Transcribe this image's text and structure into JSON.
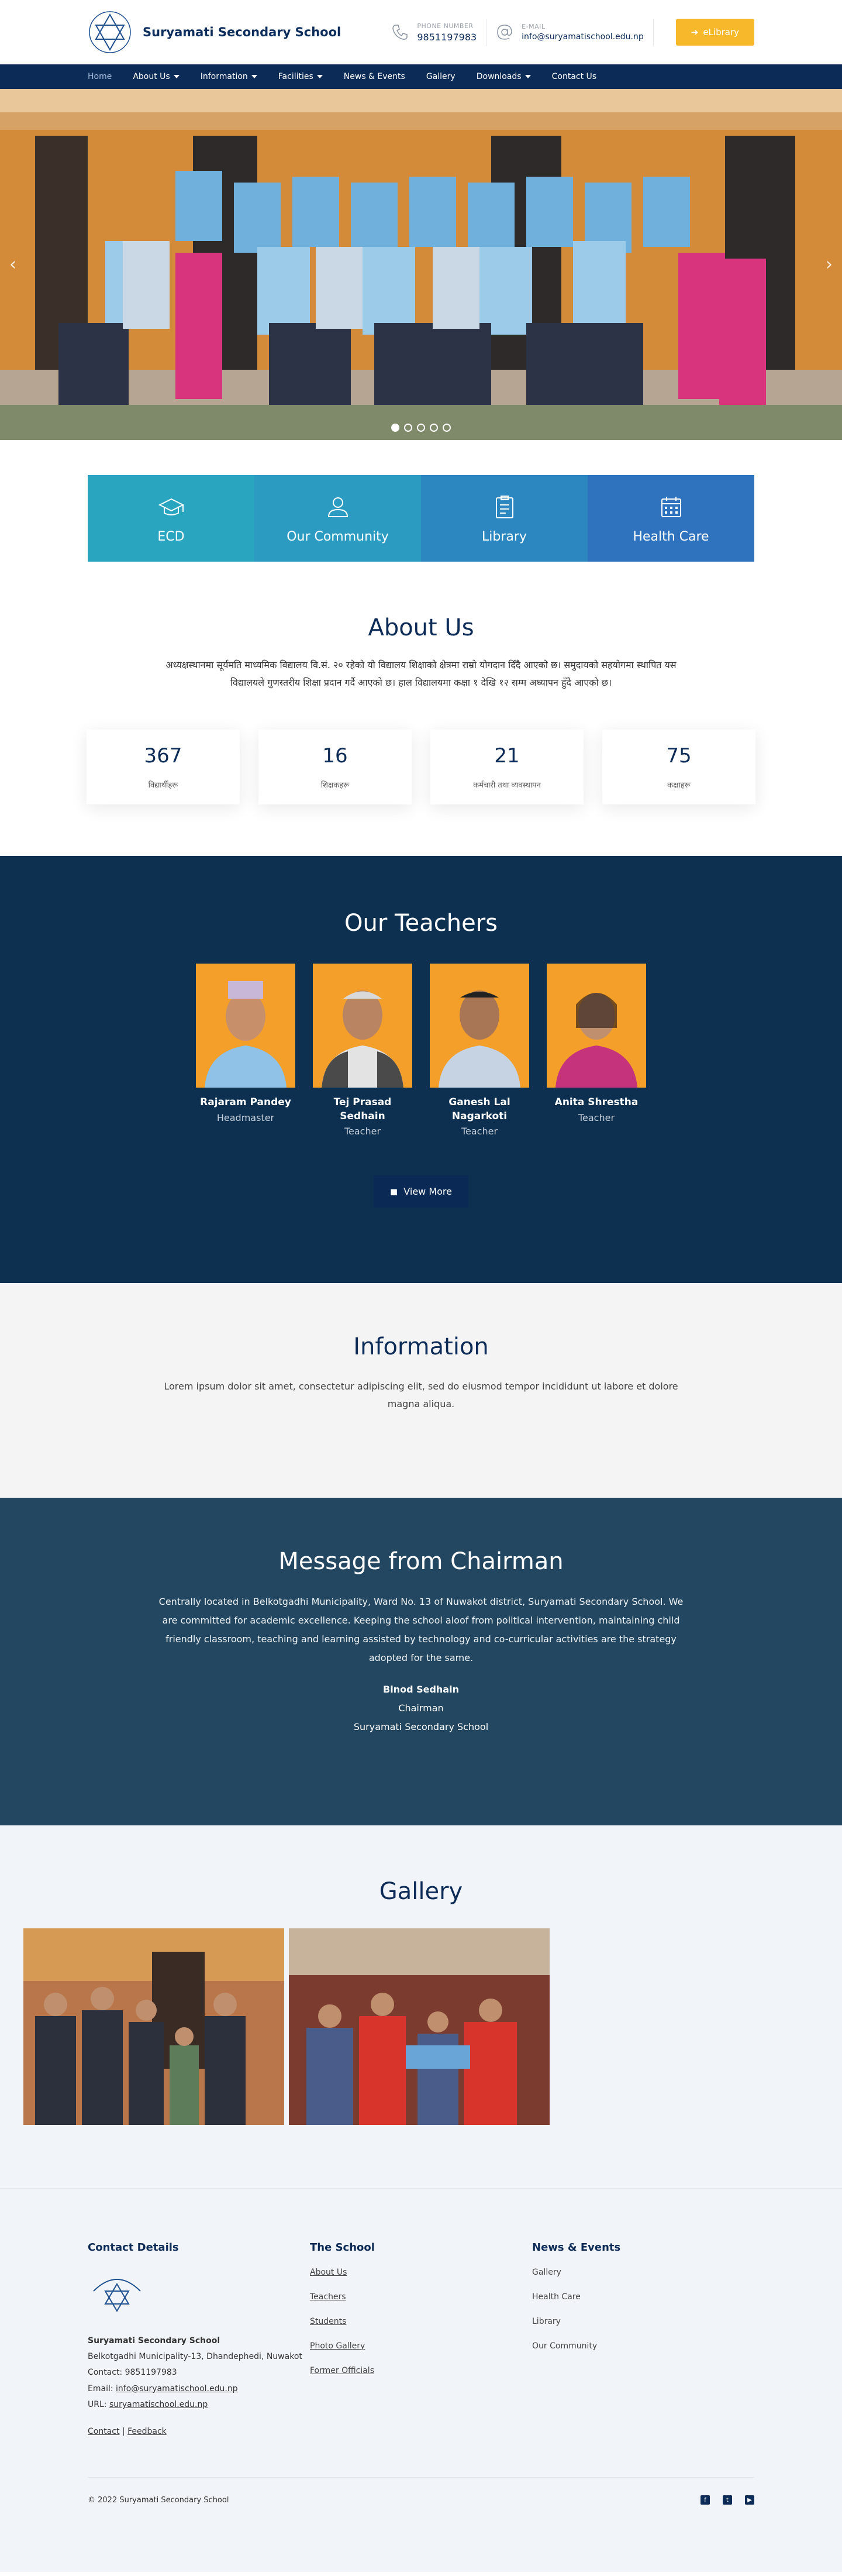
{
  "header": {
    "school_name": "Suryamati Secondary School",
    "phone_label": "PHONE NUMBER",
    "phone": "9851197983",
    "email_label": "E-MAIL",
    "email": "info@suryamatischool.edu.np",
    "elibrary": "eLibrary",
    "icons": [
      "phone-icon",
      "at-icon",
      "arrow-right-icon"
    ]
  },
  "nav": {
    "items": [
      {
        "label": "Home"
      },
      {
        "label": "About Us"
      },
      {
        "label": "Information"
      },
      {
        "label": "Facilities"
      },
      {
        "label": "News & Events"
      },
      {
        "label": "Gallery"
      },
      {
        "label": "Downloads"
      },
      {
        "label": "Contact Us"
      }
    ]
  },
  "hero": {
    "prev": "‹",
    "next": "›",
    "slides": 5,
    "active_slide": 1
  },
  "tiles": [
    {
      "label": "ECD",
      "color": "#2aa5bf",
      "icon": "graduation-cap-icon"
    },
    {
      "label": "Our Community",
      "color": "#2c9bc2",
      "icon": "community-icon"
    },
    {
      "label": "Library",
      "color": "#2c87c0",
      "icon": "clipboard-icon"
    },
    {
      "label": "Health Care",
      "color": "#2f72bd",
      "icon": "calendar-icon"
    }
  ],
  "about": {
    "title": "About Us",
    "text": "अध्यक्षस्थानमा सूर्यमति माध्यमिक विद्यालय वि.सं. २० रहेको यो विद्यालय शिक्षाको क्षेत्रमा राम्रो योगदान दिँदै आएको छ। समुदायको सहयोगमा स्थापित यस विद्यालयले गुणस्तरीय शिक्षा प्रदान गर्दै आएको छ। हाल विद्यालयमा कक्षा १ देखि १२ सम्म अध्यापन हुँदै आएको छ।",
    "stats": [
      {
        "num": "367",
        "label": "विद्यार्थीहरू"
      },
      {
        "num": "16",
        "label": "शिक्षकहरू"
      },
      {
        "num": "21",
        "label": "कर्मचारी तथा व्यवस्थापन"
      },
      {
        "num": "75",
        "label": "कक्षाहरू"
      }
    ]
  },
  "teachers": {
    "title": "Our Teachers",
    "list": [
      {
        "name": "Rajaram Pandey",
        "role": "Headmaster"
      },
      {
        "name": "Tej Prasad Sedhain",
        "role": "Teacher"
      },
      {
        "name": "Ganesh Lal Nagarkoti",
        "role": "Teacher"
      },
      {
        "name": "Anita Shrestha",
        "role": "Teacher"
      }
    ],
    "view_more": "View More"
  },
  "information": {
    "title": "Information",
    "text": "Lorem ipsum dolor sit amet, consectetur adipiscing elit, sed do eiusmod tempor incididunt ut labore et dolore magna aliqua."
  },
  "chairman": {
    "title": "Message from Chairman",
    "text": "Centrally located in Belkotgadhi Municipality, Ward No. 13 of Nuwakot district, Suryamati Secondary School. We are committed for academic excellence. Keeping the school aloof from political intervention, maintaining child friendly classroom, teaching and learning assisted by technology and co-curricular activities are the strategy adopted for the same.",
    "name": "Binod Sedhain",
    "role": "Chairman",
    "org": "Suryamati Secondary School"
  },
  "gallery": {
    "title": "Gallery"
  },
  "footer": {
    "contact_title": "Contact Details",
    "school": "Suryamati Secondary School",
    "address": "Belkotgadhi Municipality-13, Dhandephedi, Nuwakot",
    "contact": "Contact: 9851197983",
    "email_prefix": "Email: ",
    "email": "info@suryamatischool.edu.np",
    "url_prefix": "URL: ",
    "url": "suryamatischool.edu.np",
    "link_contact": "Contact",
    "sep": " | ",
    "link_feedback": "Feedback",
    "school_title": "The School",
    "school_links": [
      "About Us",
      "Teachers",
      "Students",
      "Photo Gallery",
      "Former Officials"
    ],
    "news_title": "News & Events",
    "news_links": [
      "Gallery",
      "Health Care",
      "Library",
      "Our Community"
    ],
    "copyright": "© 2022 Suryamati Secondary School",
    "socials": [
      "facebook-icon",
      "twitter-icon",
      "youtube-icon"
    ]
  }
}
